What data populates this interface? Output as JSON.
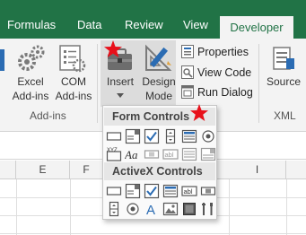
{
  "tabs": {
    "formulas": "Formulas",
    "data": "Data",
    "review": "Review",
    "view": "View",
    "developer": "Developer"
  },
  "ribbon": {
    "addins_group": {
      "label": "Add-ins",
      "excel_addins": [
        "Excel",
        "Add-ins"
      ],
      "com_addins": [
        "COM",
        "Add-ins"
      ]
    },
    "controls_group": {
      "insert": "Insert",
      "design_mode": [
        "Design",
        "Mode"
      ],
      "properties": "Properties",
      "view_code": "View Code",
      "run_dialog": "Run Dialog"
    },
    "xml_group": {
      "label": "XML",
      "source": "Source"
    }
  },
  "dropdown": {
    "form_controls_header": "Form Controls",
    "activex_controls_header": "ActiveX Controls",
    "form_controls": [
      "button-form-control",
      "combo-box-form-control",
      "check-box-form-control",
      "spin-button-form-control",
      "list-box-form-control",
      "option-button-form-control",
      "group-box-form-control",
      "label-form-control",
      "scroll-bar-form-control",
      "text-field-form-control",
      "combo-list-edit-form-control",
      "combo-dropdown-edit-form-control"
    ],
    "activex_controls": [
      "command-button-activex",
      "combo-box-activex",
      "check-box-activex",
      "list-box-activex",
      "text-box-activex",
      "scroll-bar-activex",
      "spin-button-activex",
      "option-button-activex",
      "label-activex",
      "image-activex",
      "toggle-button-activex",
      "more-controls-activex"
    ]
  },
  "sheet": {
    "columns": [
      "E",
      "F",
      "I"
    ]
  },
  "colors": {
    "excel_green": "#217346",
    "annotation_star": "#e8101a",
    "ribbon_bg": "#f3f3f3"
  }
}
